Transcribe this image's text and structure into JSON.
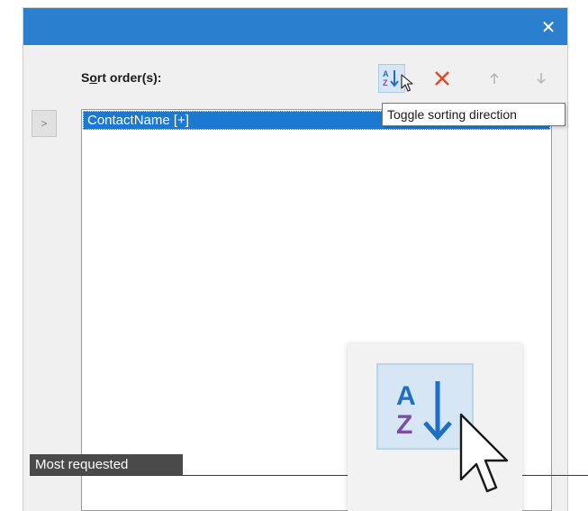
{
  "dialog": {
    "close_symbol": "✕",
    "sort_label_prefix": "S",
    "sort_label_underlined": "o",
    "sort_label_rest": "rt order(s):",
    "move_button_label": ">",
    "toolbar": {
      "sort_icon": "az-sort-icon",
      "delete_icon": "delete-x-icon",
      "up_icon": "arrow-up-icon",
      "down_icon": "arrow-down-icon"
    },
    "list_items": [
      "ContactName [+]"
    ],
    "tooltip": "Toggle sorting direction"
  },
  "badge": "Most requested",
  "colors": {
    "titlebar": "#2b7fcf",
    "selection": "#1c79d3",
    "delete_red": "#e04a2f",
    "icon_blue": "#1f6fc6",
    "icon_purple": "#7a4ea6"
  }
}
